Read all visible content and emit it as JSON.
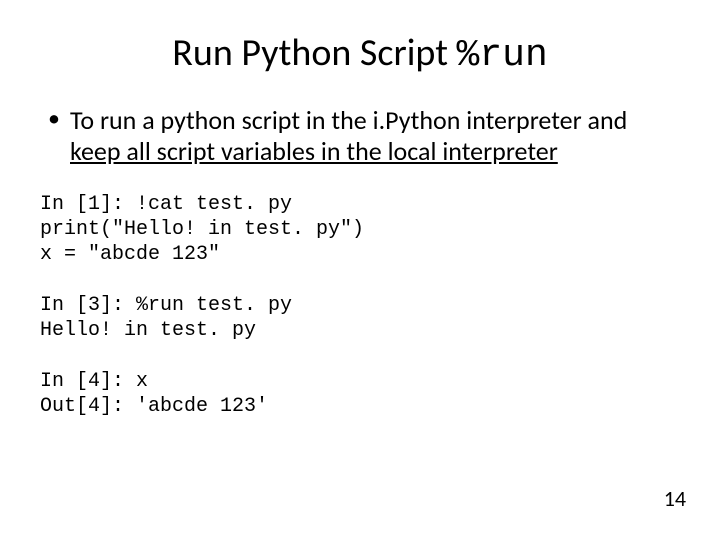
{
  "title": {
    "text": "Run Python Script ",
    "mono": "%run"
  },
  "bullet": {
    "pre": "To run a python script in the i.Python interpreter and ",
    "underline": "keep all script variables in the local interpreter"
  },
  "code1": "In [1]: !cat test. py\nprint(\"Hello! in test. py\")\nx = \"abcde 123\"",
  "code2": "In [3]: %run test. py\nHello! in test. py",
  "code3": "In [4]: x\nOut[4]: 'abcde 123'",
  "pagenum": "14"
}
